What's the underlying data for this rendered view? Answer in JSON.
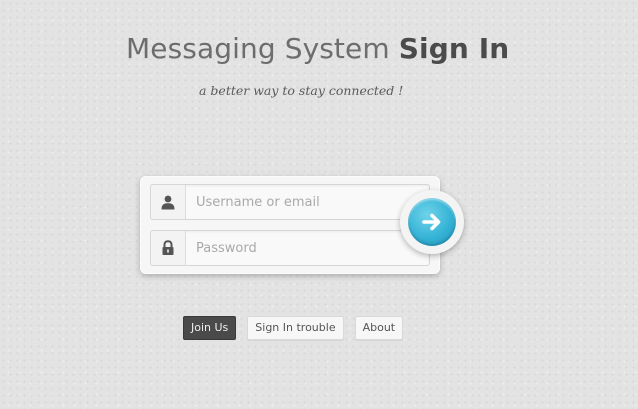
{
  "header": {
    "title_light": "Messaging System",
    "title_bold": "Sign In",
    "tagline": "a better way to stay connected !"
  },
  "form": {
    "username_placeholder": "Username or email",
    "password_placeholder": "Password",
    "username_icon": "user-icon",
    "password_icon": "lock-icon",
    "submit_icon": "arrow-right-icon"
  },
  "links": {
    "join": "Join Us",
    "trouble": "Sign In trouble",
    "about": "About"
  },
  "colors": {
    "accent": "#35b3d6",
    "background": "#e3e3e3",
    "dark_button": "#4a4a4a"
  }
}
